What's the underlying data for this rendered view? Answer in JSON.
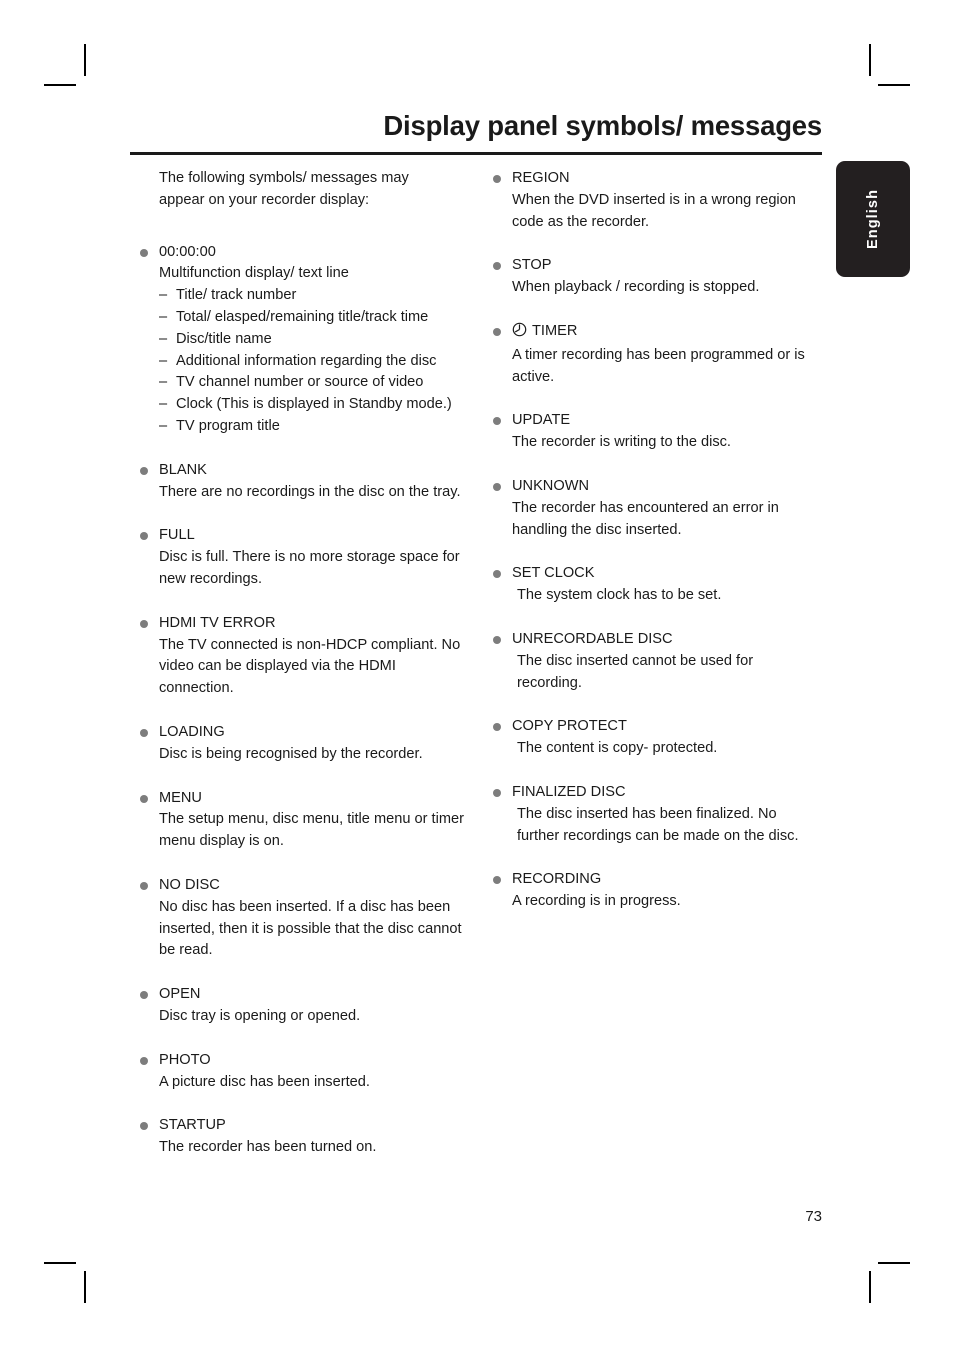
{
  "page": {
    "title": "Display panel symbols/ messages",
    "number": "73",
    "language_tab": "English"
  },
  "intro": "The following symbols/ messages may appear on your recorder display:",
  "left_column": [
    {
      "term": "00:00:00",
      "desc": "Multifunction display/ text line",
      "sub_items": [
        "Title/ track number",
        "Total/ elasped/remaining title/track time",
        "Disc/title name",
        "Additional information regarding the disc",
        "TV channel number or source of video",
        "Clock (This is displayed in Standby mode.)",
        "TV program title"
      ]
    },
    {
      "term": "BLANK",
      "desc": "There are no recordings in the disc on the tray."
    },
    {
      "term": "FULL",
      "desc": "Disc is full. There is no more storage space for new recordings."
    },
    {
      "term": "HDMI TV ERROR",
      "desc": "The TV connected is non-HDCP compliant. No video can be displayed via the HDMI connection."
    },
    {
      "term": "LOADING",
      "desc": "Disc is being recognised by the recorder."
    },
    {
      "term": "MENU",
      "desc": "The setup menu, disc menu, title menu or timer menu display is on."
    },
    {
      "term": "NO DISC",
      "desc": "No disc has been inserted. If a disc has been inserted, then it is possible that the disc cannot be read."
    },
    {
      "term": "OPEN",
      "desc": "Disc tray is opening or opened."
    },
    {
      "term": "PHOTO",
      "desc": "A picture disc has been inserted."
    },
    {
      "term": "STARTUP",
      "desc": "The recorder has been turned on."
    }
  ],
  "right_column": [
    {
      "term": "REGION",
      "desc": "When the DVD inserted is in a wrong region code as the recorder."
    },
    {
      "term": "STOP",
      "desc": "When playback / recording is stopped."
    },
    {
      "term": "TIMER",
      "icon": "clock-icon",
      "desc": "A timer recording has been programmed or is active."
    },
    {
      "term": "UPDATE",
      "desc": "The recorder is writing to the disc."
    },
    {
      "term": "UNKNOWN",
      "desc": "The recorder has encountered an error in handling the disc inserted."
    },
    {
      "term": "SET CLOCK",
      "desc": "The system clock has to be set.",
      "desc_indent": true
    },
    {
      "term": "UNRECORDABLE DISC",
      "desc": "The disc inserted cannot be used for recording.",
      "desc_indent": true
    },
    {
      "term": "COPY PROTECT",
      "desc": "The content is copy- protected.",
      "desc_indent": true
    },
    {
      "term": "FINALIZED DISC",
      "desc": "The disc inserted has been finalized. No further recordings can be made on the disc.",
      "desc_indent": true
    },
    {
      "term": "RECORDING",
      "desc": "A recording is in progress."
    }
  ],
  "colors": {
    "bullet": "#7d7d7d",
    "text": "#1a1a1a",
    "tab_background": "#231f20",
    "tab_text": "#ffffff"
  }
}
